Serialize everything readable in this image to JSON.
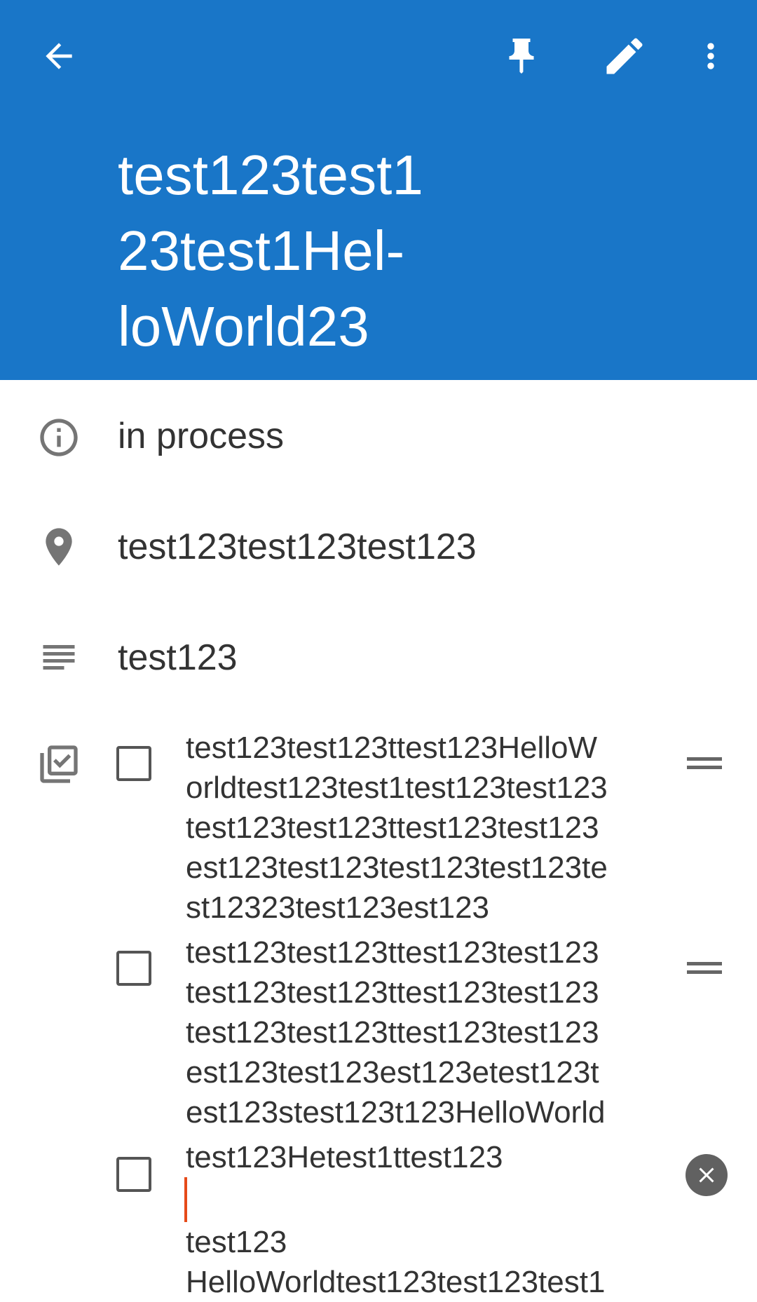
{
  "header": {
    "title_lines": [
      "test123test1",
      "23test1Hel-",
      "loWorld23"
    ],
    "colors": {
      "background": "#1976C8",
      "text": "#FFFFFF"
    },
    "icons": {
      "back": "arrow-back-icon",
      "pin": "pin-icon",
      "edit": "pencil-icon",
      "more": "more-vert-icon"
    }
  },
  "details": {
    "status": {
      "icon": "info-icon",
      "text": "in process"
    },
    "location": {
      "icon": "location-pin-icon",
      "text": "test123test123test123"
    },
    "description": {
      "icon": "notes-icon",
      "text": "test123"
    }
  },
  "checklist": {
    "icon": "checklist-icon",
    "items": [
      {
        "checked": false,
        "lines": [
          "test123test123ttest123HelloW",
          "orldtest123test1test123test123",
          "test123test123ttest123test123",
          "est123test123test123test123te",
          "st12323test123est123"
        ],
        "trailing": "drag-handle-icon"
      },
      {
        "checked": false,
        "lines": [
          "test123test123ttest123test123",
          "test123test123ttest123test123",
          "test123test123ttest123test123",
          "est123test123est123etest123t",
          "est123stest123t123HelloWorld"
        ],
        "trailing": "drag-handle-icon"
      },
      {
        "checked": false,
        "text_before_cursor": "test123Hetest1ttest123",
        "text_after_cursor": "test123",
        "second_line": "HelloWorldtest123test123test1",
        "trailing": "remove-icon"
      }
    ]
  },
  "colors": {
    "caret": "#E64A19",
    "icon_gray": "#757575"
  }
}
